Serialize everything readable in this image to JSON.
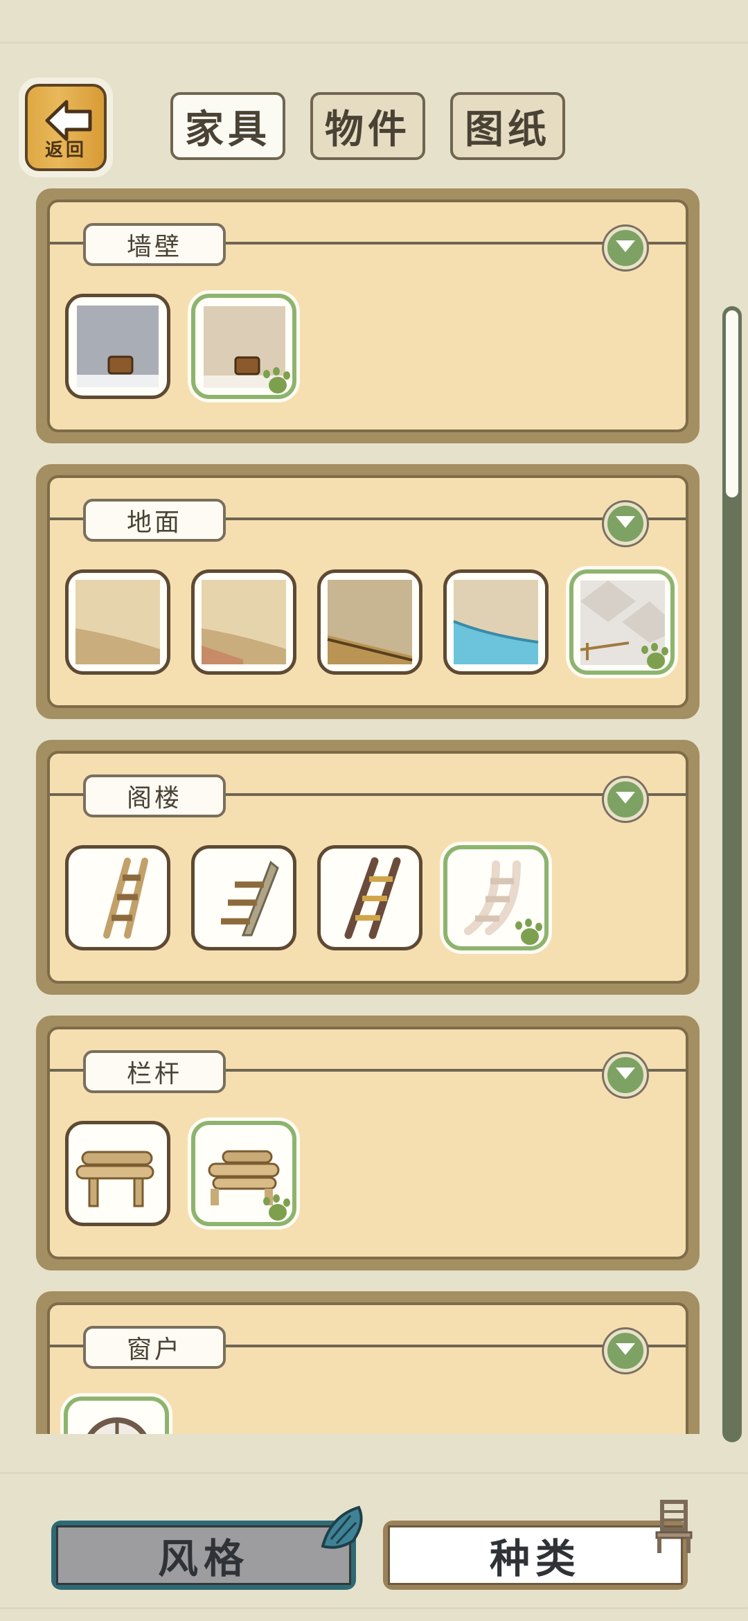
{
  "header": {
    "back_label": "返回",
    "tabs": [
      {
        "label": "家具",
        "active": true
      },
      {
        "label": "物件",
        "active": false
      },
      {
        "label": "图纸",
        "active": false
      }
    ]
  },
  "sections": [
    {
      "label": "墙壁",
      "items": [
        {
          "icon": "wall-grey-bucket-icon",
          "owned": false
        },
        {
          "icon": "wall-beige-bucket-icon",
          "owned": true
        }
      ]
    },
    {
      "label": "地面",
      "items": [
        {
          "icon": "floor-dirt-icon",
          "owned": false
        },
        {
          "icon": "floor-dirt-red-icon",
          "owned": false
        },
        {
          "icon": "floor-wood-plank-icon",
          "owned": false
        },
        {
          "icon": "floor-water-pool-icon",
          "owned": false
        },
        {
          "icon": "floor-tile-icon",
          "owned": true
        }
      ]
    },
    {
      "label": "阁楼",
      "items": [
        {
          "icon": "ladder-bamboo-icon",
          "owned": false
        },
        {
          "icon": "stairs-wooden-icon",
          "owned": false
        },
        {
          "icon": "ladder-dark-wood-icon",
          "owned": false
        },
        {
          "icon": "ladder-white-icon",
          "owned": true
        }
      ]
    },
    {
      "label": "栏杆",
      "items": [
        {
          "icon": "railing-log-icon",
          "owned": false
        },
        {
          "icon": "railing-log-double-icon",
          "owned": true
        }
      ]
    },
    {
      "label": "窗户",
      "items": [
        {
          "icon": "window-round-lattice-icon",
          "owned": true
        }
      ]
    }
  ],
  "footer": {
    "style_label": "风格",
    "kind_label": "种类",
    "style_icon": "shell-icon",
    "kind_icon": "chair-icon"
  },
  "colors": {
    "owned_border": "#8db46f",
    "paw": "#7da04f",
    "panel": "#f5dfb1",
    "background": "#e6e1cb"
  }
}
